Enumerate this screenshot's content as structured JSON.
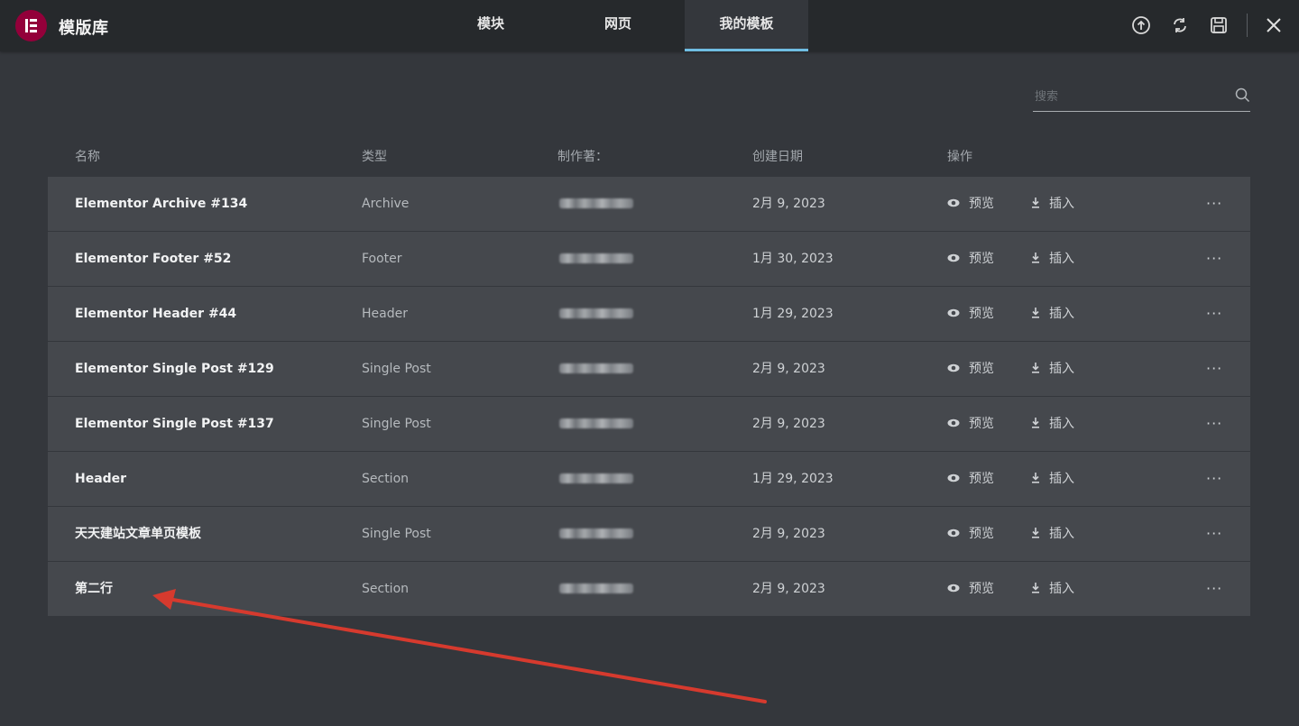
{
  "header": {
    "title": "模版库",
    "tabs": [
      {
        "label": "模块",
        "active": false
      },
      {
        "label": "网页",
        "active": false
      },
      {
        "label": "我的模板",
        "active": true
      }
    ],
    "tools": [
      "upload-icon",
      "sync-icon",
      "save-icon",
      "close-icon"
    ]
  },
  "search": {
    "placeholder": "搜索"
  },
  "table": {
    "columns": [
      "名称",
      "类型",
      "制作著：",
      "创建日期",
      "操作"
    ],
    "rows": [
      {
        "name": "Elementor Archive #134",
        "type": "Archive",
        "date": "2月 9, 2023"
      },
      {
        "name": "Elementor Footer #52",
        "type": "Footer",
        "date": "1月 30, 2023"
      },
      {
        "name": "Elementor Header #44",
        "type": "Header",
        "date": "1月 29, 2023"
      },
      {
        "name": "Elementor Single Post #129",
        "type": "Single Post",
        "date": "2月 9, 2023"
      },
      {
        "name": "Elementor Single Post #137",
        "type": "Single Post",
        "date": "2月 9, 2023"
      },
      {
        "name": "Header",
        "type": "Section",
        "date": "1月 29, 2023"
      },
      {
        "name": "天天建站文章单页模板",
        "type": "Single Post",
        "date": "2月 9, 2023"
      },
      {
        "name": "第二行",
        "type": "Section",
        "date": "2月 9, 2023"
      }
    ],
    "actions": {
      "preview": "预览",
      "insert": "插入",
      "more": "···"
    }
  },
  "colors": {
    "background": "#34373c",
    "header": "#26292c",
    "row": "#45484d",
    "brand": "#93003a",
    "tab_underline": "#6fbde2",
    "annotation_arrow": "#d63a2e"
  }
}
